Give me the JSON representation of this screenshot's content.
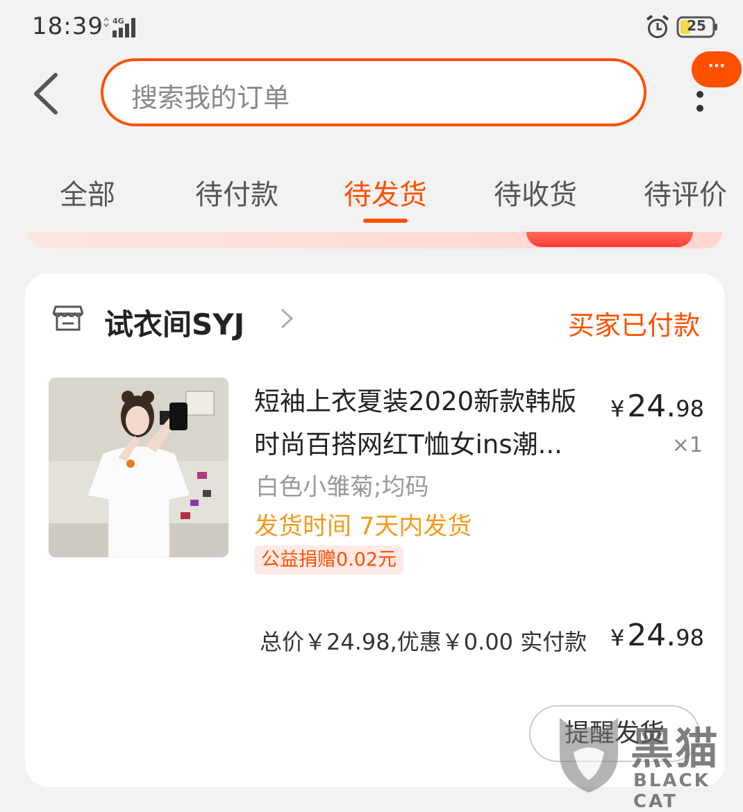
{
  "status_bar": {
    "time": "18:39",
    "network": "4G",
    "battery": "25"
  },
  "header": {
    "back_icon": "back-arrow-icon",
    "search_placeholder": "搜索我的订单",
    "more_badge": "···",
    "more_icon": "vertical-dots-icon"
  },
  "tabs": [
    {
      "label": "全部",
      "active": false
    },
    {
      "label": "待付款",
      "active": false
    },
    {
      "label": "待发货",
      "active": true
    },
    {
      "label": "待收货",
      "active": false
    },
    {
      "label": "待评价",
      "active": false
    }
  ],
  "order": {
    "shop_icon": "shop-icon",
    "shop_name": "试衣间SYJ",
    "status": "买家已付款",
    "item": {
      "title_line1": "短袖上衣夏装2020新款韩版",
      "title_line2": "时尚百搭网红T恤女ins潮...",
      "price_currency": "¥",
      "price_int": "24.",
      "price_dec": "98",
      "quantity": "×1",
      "sku": "白色小雏菊;均码",
      "shipping": "发货时间 7天内发货",
      "charity": "公益捐赠0.02元"
    },
    "summary": "总价￥24.98,优惠￥0.00 实付款",
    "paid_currency": "¥",
    "paid_int": "24.",
    "paid_dec": "98",
    "remind_button": "提醒发货"
  },
  "watermark": {
    "title": "黑猫",
    "subtitle": "BLACK CAT"
  },
  "colors": {
    "accent": "#ff5000",
    "shipping": "#f39a1c",
    "background": "#f2f2f2"
  }
}
